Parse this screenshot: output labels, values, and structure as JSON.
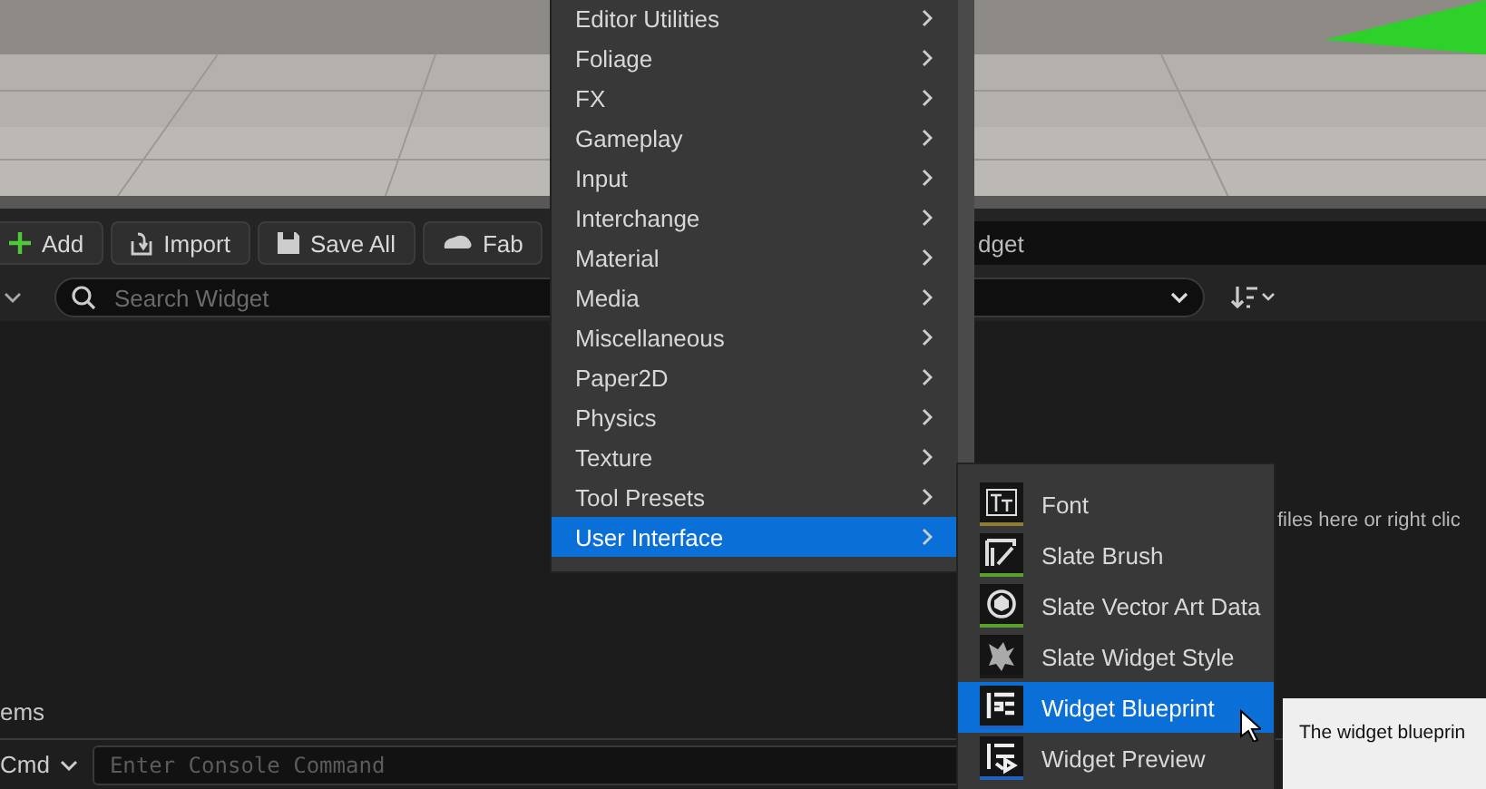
{
  "toolbar": {
    "buttons": [
      {
        "label": "Add",
        "kind": "add"
      },
      {
        "label": "Import",
        "kind": "import"
      },
      {
        "label": "Save All",
        "kind": "save"
      },
      {
        "label": "Fab",
        "kind": "fab"
      }
    ],
    "path": "dget"
  },
  "search": {
    "placeholder": "Search Widget"
  },
  "content": {
    "hint": "files here or right clic",
    "status": "ems"
  },
  "console": {
    "label": "Cmd",
    "placeholder": "Enter Console Command"
  },
  "menu": {
    "items": [
      {
        "label": "Editor Utilities",
        "selected": false
      },
      {
        "label": "Foliage",
        "selected": false
      },
      {
        "label": "FX",
        "selected": false
      },
      {
        "label": "Gameplay",
        "selected": false
      },
      {
        "label": "Input",
        "selected": false
      },
      {
        "label": "Interchange",
        "selected": false
      },
      {
        "label": "Material",
        "selected": false
      },
      {
        "label": "Media",
        "selected": false
      },
      {
        "label": "Miscellaneous",
        "selected": false
      },
      {
        "label": "Paper2D",
        "selected": false
      },
      {
        "label": "Physics",
        "selected": false
      },
      {
        "label": "Texture",
        "selected": false
      },
      {
        "label": "Tool Presets",
        "selected": false
      },
      {
        "label": "User Interface",
        "selected": true
      }
    ]
  },
  "submenu": {
    "items": [
      {
        "label": "Font",
        "kind": "font",
        "color": "#8c7d32",
        "selected": false
      },
      {
        "label": "Slate Brush",
        "kind": "brush",
        "color": "#5aa02c",
        "selected": false
      },
      {
        "label": "Slate Vector Art Data",
        "kind": "vector",
        "color": "#5aa02c",
        "selected": false
      },
      {
        "label": "Slate Widget Style",
        "kind": "style",
        "color": "#1a1a1a",
        "selected": false
      },
      {
        "label": "Widget Blueprint",
        "kind": "blueprint",
        "color": "#2060c0",
        "selected": true
      },
      {
        "label": "Widget Preview",
        "kind": "preview",
        "color": "#2060c0",
        "selected": false
      }
    ]
  },
  "tooltip": {
    "text": "The widget blueprin"
  }
}
